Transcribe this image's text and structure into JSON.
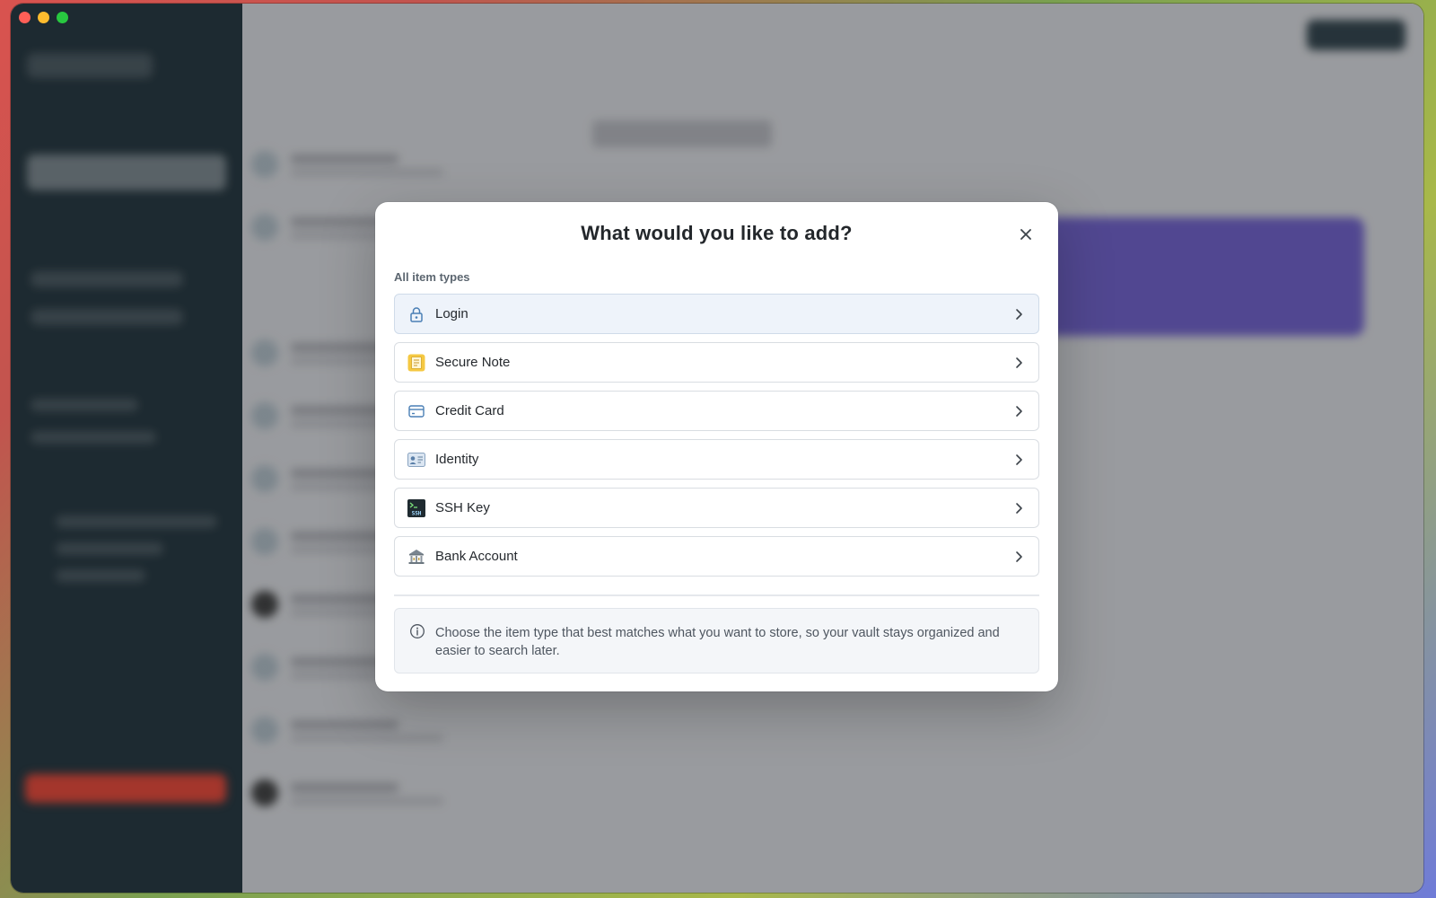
{
  "modal": {
    "title": "What would you like to add?",
    "section_label": "All item types",
    "items": [
      {
        "label": "Login",
        "icon": "lock-icon",
        "selected": true
      },
      {
        "label": "Secure Note",
        "icon": "note-icon",
        "selected": false
      },
      {
        "label": "Credit Card",
        "icon": "credit-card-icon",
        "selected": false
      },
      {
        "label": "Identity",
        "icon": "identity-card-icon",
        "selected": false
      },
      {
        "label": "SSH Key",
        "icon": "ssh-key-icon",
        "ssh_badge": "SSH",
        "selected": false
      },
      {
        "label": "Bank Account",
        "icon": "bank-icon",
        "selected": false
      }
    ],
    "info_text": "Choose the item type that best matches what you want to store, so your vault stays organized and easier to search later."
  },
  "colors": {
    "sidebar": "#1c2a31",
    "active_row": "#eef3fa",
    "accent_blue": "#5a8fc8",
    "note_yellow": "#f5c842"
  }
}
